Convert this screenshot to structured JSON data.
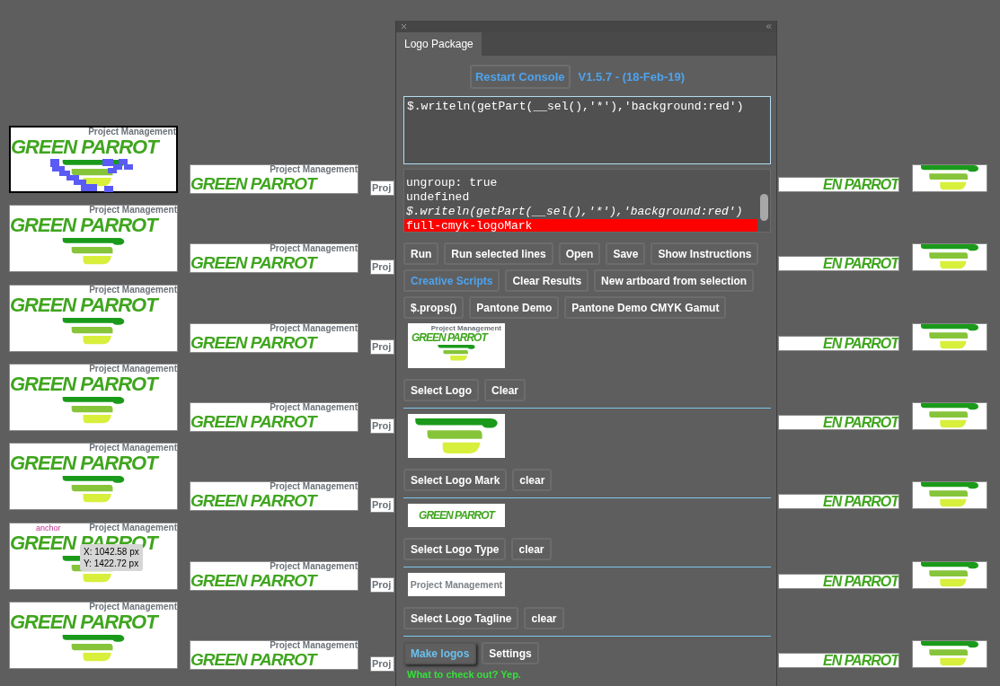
{
  "canvas": {
    "columns": [
      {
        "kind": "full",
        "artboards": [
          {
            "tagline": "Project Management",
            "wordmark": "GREEN PARROT",
            "selected": true
          },
          {
            "tagline": "Project Management",
            "wordmark": "GREEN PARROT",
            "selected": false
          },
          {
            "tagline": "Project Management",
            "wordmark": "GREEN PARROT",
            "selected": false
          },
          {
            "tagline": "Project Management",
            "wordmark": "GREEN PARROT",
            "selected": false
          },
          {
            "tagline": "Project Management",
            "wordmark": "GREEN PARROT",
            "selected": false
          },
          {
            "tagline": "Project Management",
            "wordmark": "GREEN PARROT",
            "selected": false
          },
          {
            "tagline": "Project Management",
            "wordmark": "GREEN PARROT",
            "selected": false
          }
        ]
      },
      {
        "kind": "wordmark_tagline",
        "artboards": [
          {
            "tagline": "Project Management",
            "wordmark": "GREEN PARROT",
            "selected": false
          },
          {
            "tagline": "Project Management",
            "wordmark": "GREEN PARROT",
            "selected": false
          },
          {
            "tagline": "Project Management",
            "wordmark": "GREEN PARROT",
            "selected": false
          },
          {
            "tagline": "Project Management",
            "wordmark": "GREEN PARROT",
            "selected": false
          },
          {
            "tagline": "Project Management",
            "wordmark": "GREEN PARROT",
            "selected": false
          },
          {
            "tagline": "Project Management",
            "wordmark": "GREEN PARROT",
            "selected": false
          },
          {
            "tagline": "Project Management",
            "wordmark": "GREEN PARROT",
            "selected": false
          }
        ]
      },
      {
        "kind": "tagline",
        "artboards": [
          {
            "tagline": "Proj",
            "selected": false
          },
          {
            "tagline": "Proj",
            "selected": false
          },
          {
            "tagline": "Proj",
            "selected": false
          },
          {
            "tagline": "Proj",
            "selected": false
          },
          {
            "tagline": "Proj",
            "selected": false
          },
          {
            "tagline": "Proj",
            "selected": false
          },
          {
            "tagline": "Proj",
            "selected": false
          }
        ]
      },
      {
        "kind": "wordmark",
        "artboards": [
          {
            "wordmark": "EN PARROT",
            "selected": false
          },
          {
            "wordmark": "EN PARROT",
            "selected": false
          },
          {
            "wordmark": "EN PARROT",
            "selected": false
          },
          {
            "wordmark": "EN PARROT",
            "selected": false
          },
          {
            "wordmark": "EN PARROT",
            "selected": false
          },
          {
            "wordmark": "EN PARROT",
            "selected": false
          },
          {
            "wordmark": "EN PARROT",
            "selected": false
          }
        ]
      },
      {
        "kind": "mark",
        "artboards": [
          {
            "selected": false
          },
          {
            "selected": false
          },
          {
            "selected": false
          },
          {
            "selected": false
          },
          {
            "selected": false
          },
          {
            "selected": false
          },
          {
            "selected": false
          }
        ]
      }
    ],
    "anchor_label": "anchor",
    "tooltip": {
      "x": "X: 1042.58 px",
      "y": "Y: 1422.72 px"
    }
  },
  "panel": {
    "tabs": [
      {
        "label": "Logo Package",
        "selected": true
      }
    ],
    "restart_button": "Restart Console",
    "version": "V1.5.7 - (18-Feb-19)",
    "script_input": "$.writeln(getPart(__sel(),'*'),'background:red')",
    "console_lines": [
      {
        "text": "ungroup: true",
        "kind": "plain"
      },
      {
        "text": "undefined",
        "kind": "plain"
      },
      {
        "text": "$.writeln(getPart(__sel(),'*'),'background:red')",
        "kind": "command"
      },
      {
        "text": "full-cmyk-logoMark",
        "kind": "highlight"
      }
    ],
    "button_rows": [
      [
        {
          "label": "Run",
          "kind": "normal"
        },
        {
          "label": "Run selected lines",
          "kind": "normal"
        },
        {
          "label": "Open",
          "kind": "normal"
        },
        {
          "label": "Save",
          "kind": "normal"
        },
        {
          "label": "Show Instructions",
          "kind": "normal"
        }
      ],
      [
        {
          "label": "Creative Scripts",
          "kind": "link"
        },
        {
          "label": "Clear Results",
          "kind": "normal"
        },
        {
          "label": "New artboard from selection",
          "kind": "normal"
        }
      ],
      [
        {
          "label": "$.props()",
          "kind": "normal"
        },
        {
          "label": "Pantone Demo",
          "kind": "normal"
        },
        {
          "label": "Pantone Demo CMYK Gamut",
          "kind": "normal"
        }
      ]
    ],
    "sections": [
      {
        "preview": {
          "kind": "full",
          "tagline": "Project Management",
          "wordmark": "GREEN PARROT"
        },
        "buttons": [
          {
            "label": "Select Logo",
            "kind": "normal"
          },
          {
            "label": "Clear",
            "kind": "normal"
          }
        ]
      },
      {
        "preview": {
          "kind": "mark"
        },
        "buttons": [
          {
            "label": "Select Logo Mark",
            "kind": "normal"
          },
          {
            "label": "clear",
            "kind": "normal"
          }
        ]
      },
      {
        "preview": {
          "kind": "wordmark",
          "wordmark": "GREEN PARROT"
        },
        "buttons": [
          {
            "label": "Select Logo Type",
            "kind": "normal"
          },
          {
            "label": "clear",
            "kind": "normal"
          }
        ]
      },
      {
        "preview": {
          "kind": "tagline",
          "tagline": "Project Management"
        },
        "buttons": [
          {
            "label": "Select Logo Tagline",
            "kind": "normal"
          },
          {
            "label": "clear",
            "kind": "normal"
          }
        ]
      }
    ],
    "footer_buttons": [
      {
        "label": "Make logos",
        "kind": "primary"
      },
      {
        "label": "Settings",
        "kind": "normal"
      }
    ],
    "status": "What to check out? Yep."
  }
}
